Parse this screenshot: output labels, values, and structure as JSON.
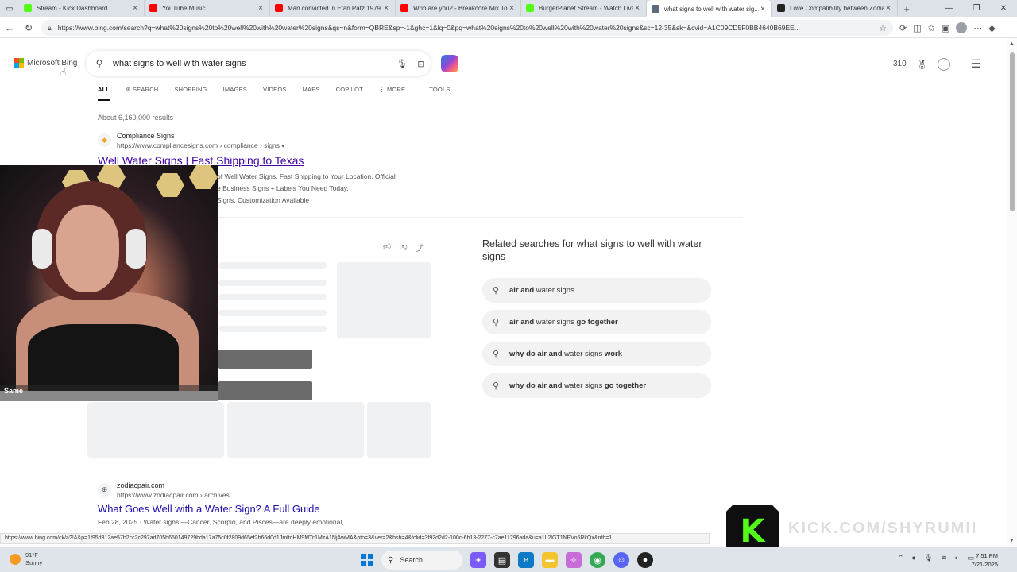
{
  "browser": {
    "tabs": [
      {
        "title": "Stream - Kick Dashboard",
        "color": "#53fc18"
      },
      {
        "title": "YouTube Music",
        "color": "#ff0000"
      },
      {
        "title": "Man convicted in Etan Patz 1979...",
        "color": "#ff0000"
      },
      {
        "title": "Who are you? - Breakcore Mix To...",
        "color": "#ff0000"
      },
      {
        "title": "BurgerPlanet Stream - Watch Live...",
        "color": "#53fc18"
      },
      {
        "title": "what signs to well with water sig...",
        "color": "#5b6b7a"
      },
      {
        "title": "Love Compatibility between Zodia...",
        "color": "#222222"
      }
    ],
    "url": "https://www.bing.com/search?q=what%20signs%20to%20well%20with%20water%20signs&qs=n&form=QBRE&sp=-1&ghc=1&lq=0&pq=what%20signs%20to%20well%20with%20water%20signs&sc=12-35&sk=&cvid=A1C09CD5F0BB4640B69EE..."
  },
  "bing": {
    "logo": "Microsoft Bing",
    "query": "what signs to well with water signs",
    "points": "310",
    "scopes": [
      "ALL",
      "SEARCH",
      "SHOPPING",
      "IMAGES",
      "VIDEOS",
      "MAPS",
      "COPILOT",
      "MORE",
      "TOOLS"
    ],
    "count": "About 6,160,000 results"
  },
  "results": [
    {
      "site": "Compliance Signs",
      "url": "https://www.compliancesigns.com › compliance › signs",
      "title": "Well Water Signs | Fast Shipping to Texas",
      "snippet_lines": [
        "of Well Water Signs. Fast Shipping to Your Location. Official",
        "e Business Signs + Labels You Need Today.",
        "Signs, Customization Available"
      ]
    },
    {
      "site": "zodiacpair.com",
      "url": "https://www.zodiacpair.com › archives",
      "title": "What Goes Well with a Water Sign? A Full Guide",
      "snippet": "Feb 28, 2025 · Water signs —Cancer, Scorpio, and Pisces—are deeply emotional,"
    }
  ],
  "related": {
    "title": "Related searches for what signs to well with water signs",
    "items": [
      {
        "bold": "air and",
        "normal": " water signs",
        "bold2": ""
      },
      {
        "bold": "air and",
        "normal": " water signs ",
        "bold2": "go together"
      },
      {
        "bold": "why do air and",
        "normal": " water signs ",
        "bold2": "work"
      },
      {
        "bold": "why do air and",
        "normal": " water signs ",
        "bold2": "go together"
      }
    ]
  },
  "overlay": {
    "cam_label": "Same",
    "kick_letter": "K",
    "kick_url": "KICK.COM/SHYRUMII"
  },
  "status_url": "https://www.bing.com/ck/a?!&&p=1f95d312ae57b2cc2c297ad705b650149729bda17a75c0f2809d65ef2b66d0d1JmltdHM9MTc1MzA1NjAwMA&ptn=3&ver=2&hsh=4&fclid=3f92d2d2-100c-6b13-2277-c7ae11296ada&u=a1L2lGT1NPVo5RkQx&ntb=1",
  "taskbar": {
    "temp": "91°F",
    "weather": "Sunny",
    "search": "Search",
    "time": "7:51 PM",
    "date": "7/21/2025"
  }
}
